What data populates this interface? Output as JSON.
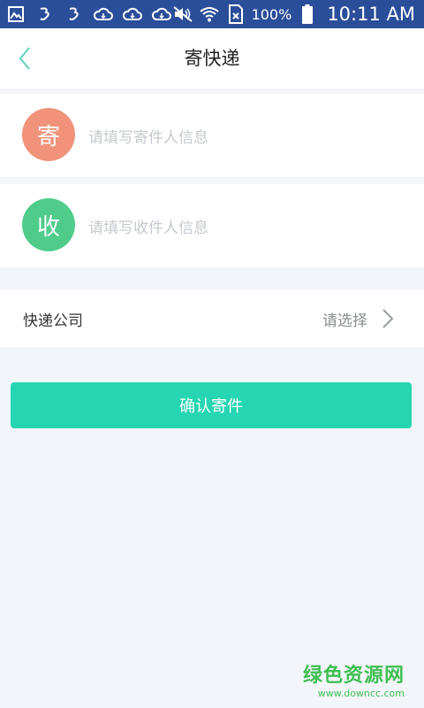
{
  "status_bar": {
    "battery_percent": "100%",
    "time": "10:11 AM",
    "icons": [
      "gallery-icon",
      "brand-app-icon",
      "brand-app-icon",
      "cloud-icon",
      "cloud-icon",
      "cloud-icon",
      "mute-icon",
      "wifi-icon",
      "sim-x-icon",
      "battery-icon"
    ]
  },
  "nav": {
    "title": "寄快递",
    "back_icon": "chevron-left-icon"
  },
  "sender": {
    "badge": "寄",
    "placeholder": "请填写寄件人信息",
    "color": "#f0937a"
  },
  "receiver": {
    "badge": "收",
    "placeholder": "请填写收件人信息",
    "color": "#4fcc8a"
  },
  "courier": {
    "label": "快递公司",
    "value": "请选择",
    "chevron_icon": "chevron-right-icon"
  },
  "confirm_button": {
    "label": "确认寄件",
    "color": "#26d5b2"
  },
  "watermark": {
    "title": "绿色资源网",
    "url": "www.downcc.com",
    "color": "#3fbf53"
  },
  "theme": {
    "accent": "#26d5b2",
    "status_bar": "#2b4e9a",
    "background": "#f2f5f9"
  }
}
